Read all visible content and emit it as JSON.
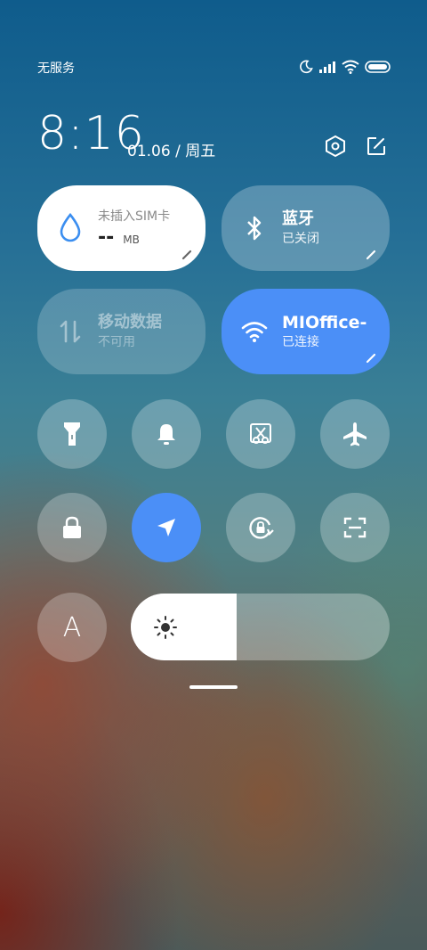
{
  "status": {
    "carrier": "无服务"
  },
  "header": {
    "time": "8:16",
    "date": "01.06 / 周五"
  },
  "tiles": {
    "data_usage": {
      "title": "未插入SIM卡",
      "value": "--",
      "unit": "MB"
    },
    "bluetooth": {
      "title": "蓝牙",
      "subtitle": "已关闭"
    },
    "mobile_data": {
      "title": "移动数据",
      "subtitle": "不可用"
    },
    "wifi": {
      "title": "MIOffice-",
      "subtitle": "已连接"
    }
  },
  "toggles": {
    "row1": [
      "flashlight-icon",
      "bell-icon",
      "screenshot-icon",
      "airplane-icon"
    ],
    "row2": [
      "lock-icon",
      "location-icon",
      "rotation-lock-icon",
      "scan-icon"
    ]
  },
  "brightness": {
    "level_percent": 41,
    "auto_label": "A"
  },
  "colors": {
    "accent": "#4b8ff7",
    "tile_white": "#ffffff",
    "tile_translucent": "rgba(255,255,255,0.25)"
  }
}
